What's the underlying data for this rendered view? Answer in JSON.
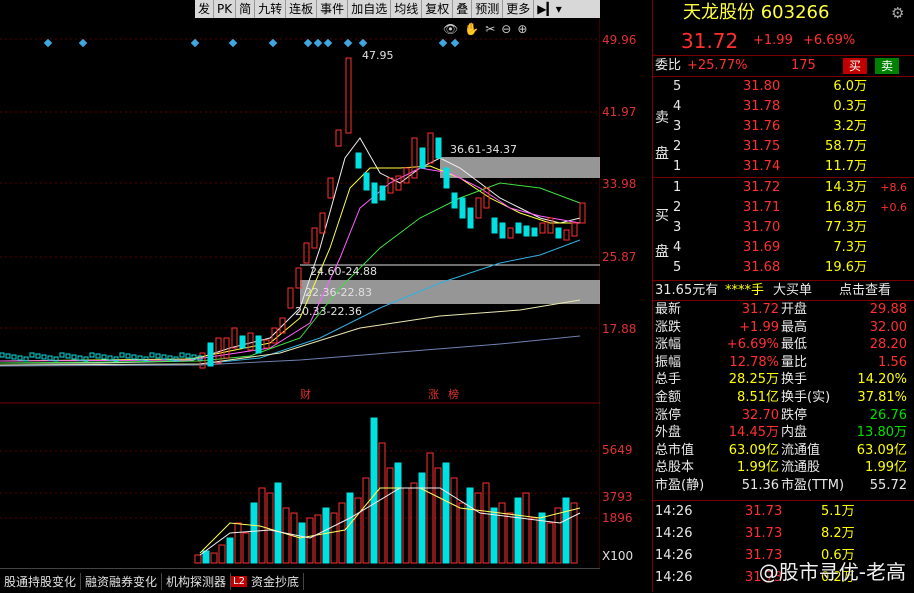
{
  "toolbar": {
    "items": [
      "发",
      "PK",
      "简",
      "九转",
      "连板",
      "事件",
      "加自选",
      "均线",
      "复权",
      "叠",
      "预测",
      "更多"
    ],
    "arrow_label": "▶▎▾"
  },
  "chart": {
    "price_labels": [
      "49.96",
      "41.97",
      "33.98",
      "25.87",
      "17.88"
    ],
    "volume_labels": [
      "5649",
      "3793",
      "1896"
    ],
    "volume_unit": "X100",
    "high_label": "47.95",
    "zones": [
      "36.61-34.37",
      "24.60-24.88",
      "22.36-22.83",
      "20.33-22.36"
    ],
    "event_marks": [
      "财",
      "涨",
      "榜"
    ]
  },
  "bottom_tabs": [
    "股通持股变化",
    "融资融券变化",
    "机构探测器",
    "资金抄底"
  ],
  "l2_badge": "L2",
  "panel": {
    "title": "天龙股份 603266",
    "price": "31.72",
    "change": "+1.99",
    "change_pct": "+6.69%",
    "weibi_label": "委比",
    "weibi_value": "+25.77%",
    "weicha_value": "175",
    "sell_btn": "买",
    "buy_btn": "卖",
    "sell_side_label": [
      "卖",
      "盘"
    ],
    "buy_side_label": [
      "买",
      "盘"
    ],
    "asks": [
      {
        "level": "5",
        "price": "31.80",
        "vol": "6.0万"
      },
      {
        "level": "4",
        "price": "31.78",
        "vol": "0.3万"
      },
      {
        "level": "3",
        "price": "31.76",
        "vol": "3.2万"
      },
      {
        "level": "2",
        "price": "31.75",
        "vol": "58.7万"
      },
      {
        "level": "1",
        "price": "31.74",
        "vol": "11.7万"
      }
    ],
    "bids": [
      {
        "level": "1",
        "price": "31.72",
        "vol": "14.3万",
        "chg": "+8.6"
      },
      {
        "level": "2",
        "price": "31.71",
        "vol": "16.8万",
        "chg": "+0.6"
      },
      {
        "level": "3",
        "price": "31.70",
        "vol": "77.3万",
        "chg": ""
      },
      {
        "level": "4",
        "price": "31.69",
        "vol": "7.3万",
        "chg": ""
      },
      {
        "level": "5",
        "price": "31.68",
        "vol": "19.6万",
        "chg": ""
      }
    ],
    "big_order": {
      "price": "31.65元有",
      "stars": "****手",
      "label": "大买单",
      "link": "点击查看"
    },
    "stats": [
      {
        "l1": "最新",
        "v1": "31.72",
        "c1": "red",
        "l2": "开盘",
        "v2": "29.88",
        "c2": "red"
      },
      {
        "l1": "涨跌",
        "v1": "+1.99",
        "c1": "red",
        "l2": "最高",
        "v2": "32.00",
        "c2": "red"
      },
      {
        "l1": "涨幅",
        "v1": "+6.69%",
        "c1": "red",
        "l2": "最低",
        "v2": "28.20",
        "c2": "red"
      },
      {
        "l1": "振幅",
        "v1": "12.78%",
        "c1": "red",
        "l2": "量比",
        "v2": "1.56",
        "c2": "red"
      },
      {
        "l1": "总手",
        "v1": "28.25万",
        "c1": "yellow",
        "l2": "换手",
        "v2": "14.20%",
        "c2": "yellow"
      },
      {
        "l1": "金额",
        "v1": "8.51亿",
        "c1": "yellow",
        "l2": "换手(实)",
        "v2": "37.81%",
        "c2": "yellow"
      },
      {
        "l1": "涨停",
        "v1": "32.70",
        "c1": "red",
        "l2": "跌停",
        "v2": "26.76",
        "c2": "green"
      },
      {
        "l1": "外盘",
        "v1": "14.45万",
        "c1": "red",
        "l2": "内盘",
        "v2": "13.80万",
        "c2": "green"
      },
      {
        "l1": "总市值",
        "v1": "63.09亿",
        "c1": "yellow",
        "l2": "流通值",
        "v2": "63.09亿",
        "c2": "yellow"
      },
      {
        "l1": "总股本",
        "v1": "1.99亿",
        "c1": "yellow",
        "l2": "流通股",
        "v2": "1.99亿",
        "c2": "yellow"
      },
      {
        "l1": "市盈(静)",
        "v1": "51.36",
        "c1": "white",
        "l2": "市盈(TTM)",
        "v2": "55.72",
        "c2": "white"
      }
    ],
    "ticks": [
      {
        "time": "14:26",
        "price": "31.73",
        "vol": "5.1万"
      },
      {
        "time": "14:26",
        "price": "31.73",
        "vol": "8.2万"
      },
      {
        "time": "14:26",
        "price": "31.73",
        "vol": "0.6万"
      },
      {
        "time": "14:26",
        "price": "31.73",
        "vol": "0.2万"
      }
    ]
  },
  "watermark": "@股市寻优-老高",
  "colors": {
    "up": "#ff3030",
    "down": "#00ffff",
    "bg": "#000000",
    "border": "#7a0000"
  }
}
